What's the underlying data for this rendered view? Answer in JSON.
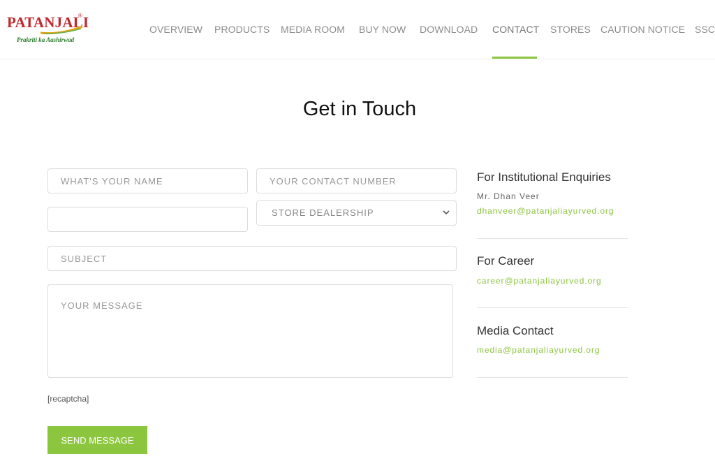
{
  "brand": {
    "name": "PATANJALI",
    "reg": "®",
    "tagline": "Prakriti ka Aashirwad",
    "colors": {
      "red": "#c0272d",
      "green": "#2d7d2d",
      "accent": "#8cc63f"
    }
  },
  "nav": {
    "items": [
      {
        "label": "OVERVIEW"
      },
      {
        "label": "PRODUCTS"
      },
      {
        "label": "MEDIA ROOM"
      },
      {
        "label": "BUY NOW"
      },
      {
        "label": "DOWNLOAD"
      },
      {
        "label": "CONTACT",
        "active": true
      },
      {
        "label": "STORES"
      },
      {
        "label": "CAUTION NOTICE"
      },
      {
        "label": "SSC"
      }
    ]
  },
  "page": {
    "title": "Get in Touch"
  },
  "form": {
    "name_placeholder": "WHAT'S YOUR NAME",
    "contact_placeholder": "YOUR CONTACT NUMBER",
    "email_value": "",
    "enquiry_selected": "STORE DEALERSHIP",
    "subject_placeholder": "SUBJECT",
    "message_placeholder": "YOUR MESSAGE",
    "recaptcha": "[recaptcha]",
    "send_label": "SEND MESSAGE"
  },
  "contacts": {
    "institutional": {
      "title": "For Institutional Enquiries",
      "person": "Mr. Dhan Veer",
      "email": "dhanveer@patanjaliayurved.org"
    },
    "career": {
      "title": "For Career",
      "email": "career@patanjaliayurved.org"
    },
    "media": {
      "title": "Media Contact",
      "email": "media@patanjaliayurved.org"
    }
  }
}
